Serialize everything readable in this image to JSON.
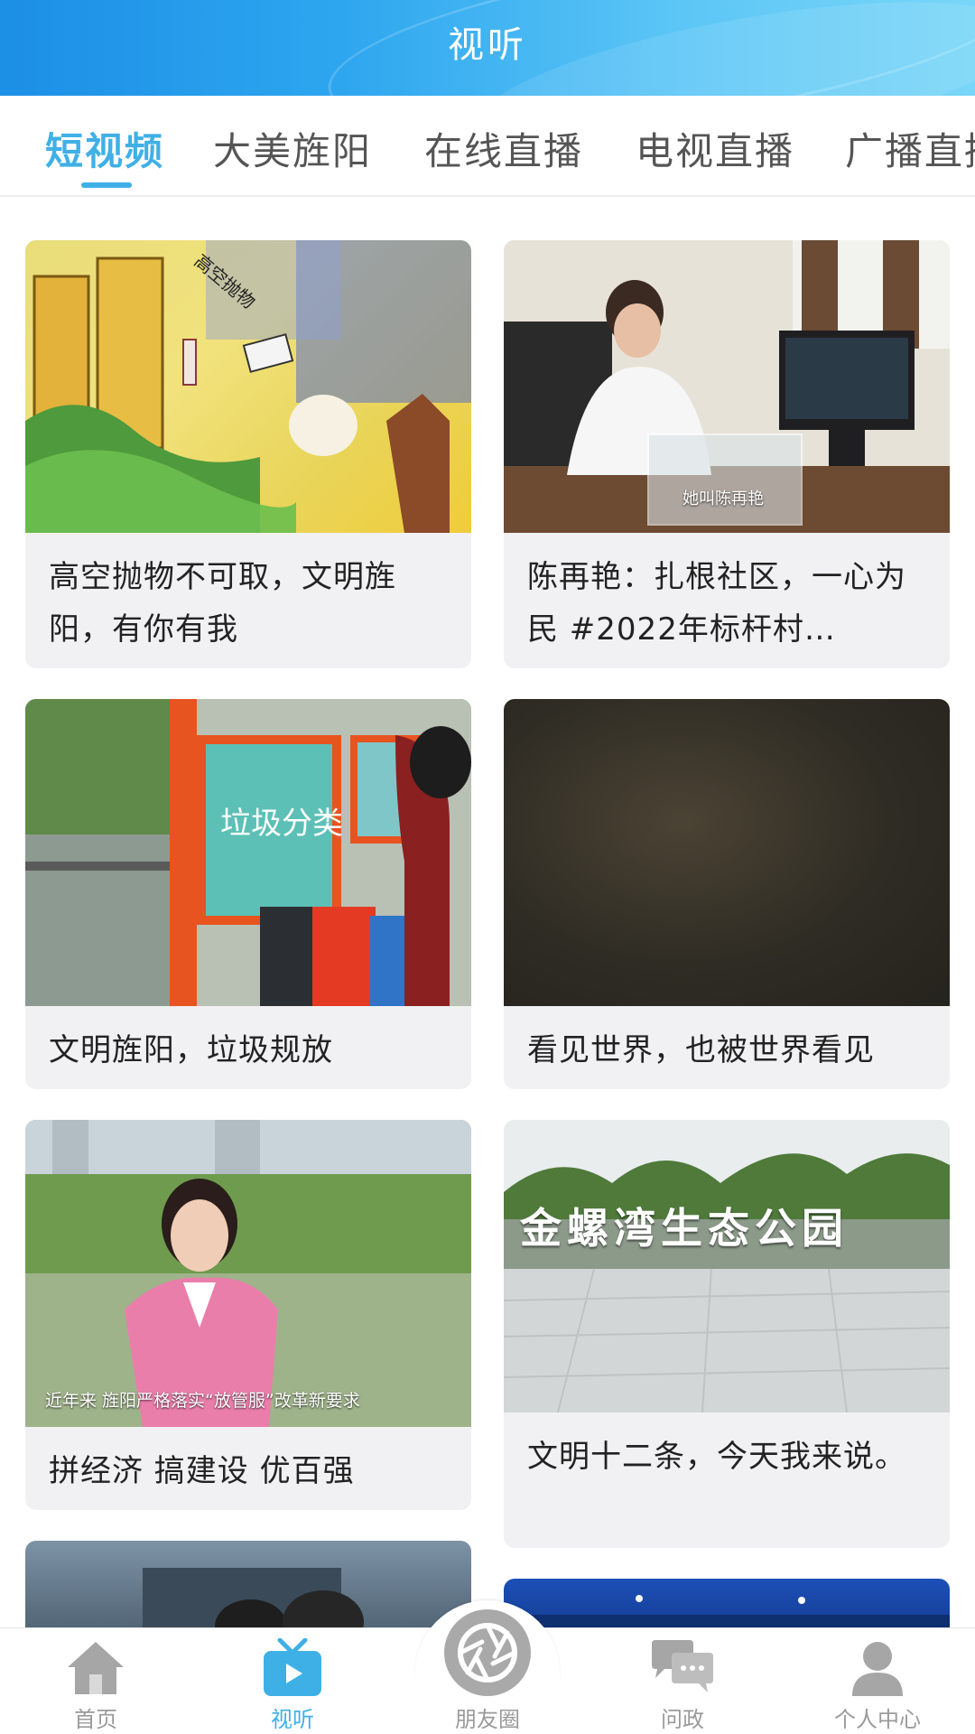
{
  "header": {
    "title": "视听"
  },
  "tabs": [
    {
      "label": "短视频",
      "active": true
    },
    {
      "label": "大美旌阳",
      "active": false
    },
    {
      "label": "在线直播",
      "active": false
    },
    {
      "label": "电视直播",
      "active": false
    },
    {
      "label": "广播直播",
      "active": false
    }
  ],
  "videos": [
    {
      "title": "高空抛物不可取，文明旌阳，有你有我",
      "overlay_text": "高空抛物"
    },
    {
      "title": "陈再艳：扎根社区，一心为民 #2022年标杆村…",
      "caption": "她叫陈再艳"
    },
    {
      "title": "文明旌阳，垃圾规放",
      "overlay_text": "垃圾分类"
    },
    {
      "title": "看见世界，也被世界看见"
    },
    {
      "title": "拼经济 搞建设 优百强",
      "caption": "近年来 旌阳严格落实“放管服”改革新要求"
    },
    {
      "title": "文明十二条，今天我来说。",
      "overlay_text": "金螺湾生态公园"
    }
  ],
  "bottom_nav": [
    {
      "label": "首页",
      "icon": "home-icon",
      "active": false
    },
    {
      "label": "视听",
      "icon": "tv-icon",
      "active": true
    },
    {
      "label": "朋友圈",
      "icon": "camera-shutter-icon",
      "active": false
    },
    {
      "label": "问政",
      "icon": "chat-bubbles-icon",
      "active": false
    },
    {
      "label": "个人中心",
      "icon": "person-icon",
      "active": false
    }
  ],
  "colors": {
    "accent": "#3fb0e6",
    "header_start": "#1c8fe6",
    "header_end": "#79d6f8",
    "card_bg": "#f1f1f3"
  }
}
